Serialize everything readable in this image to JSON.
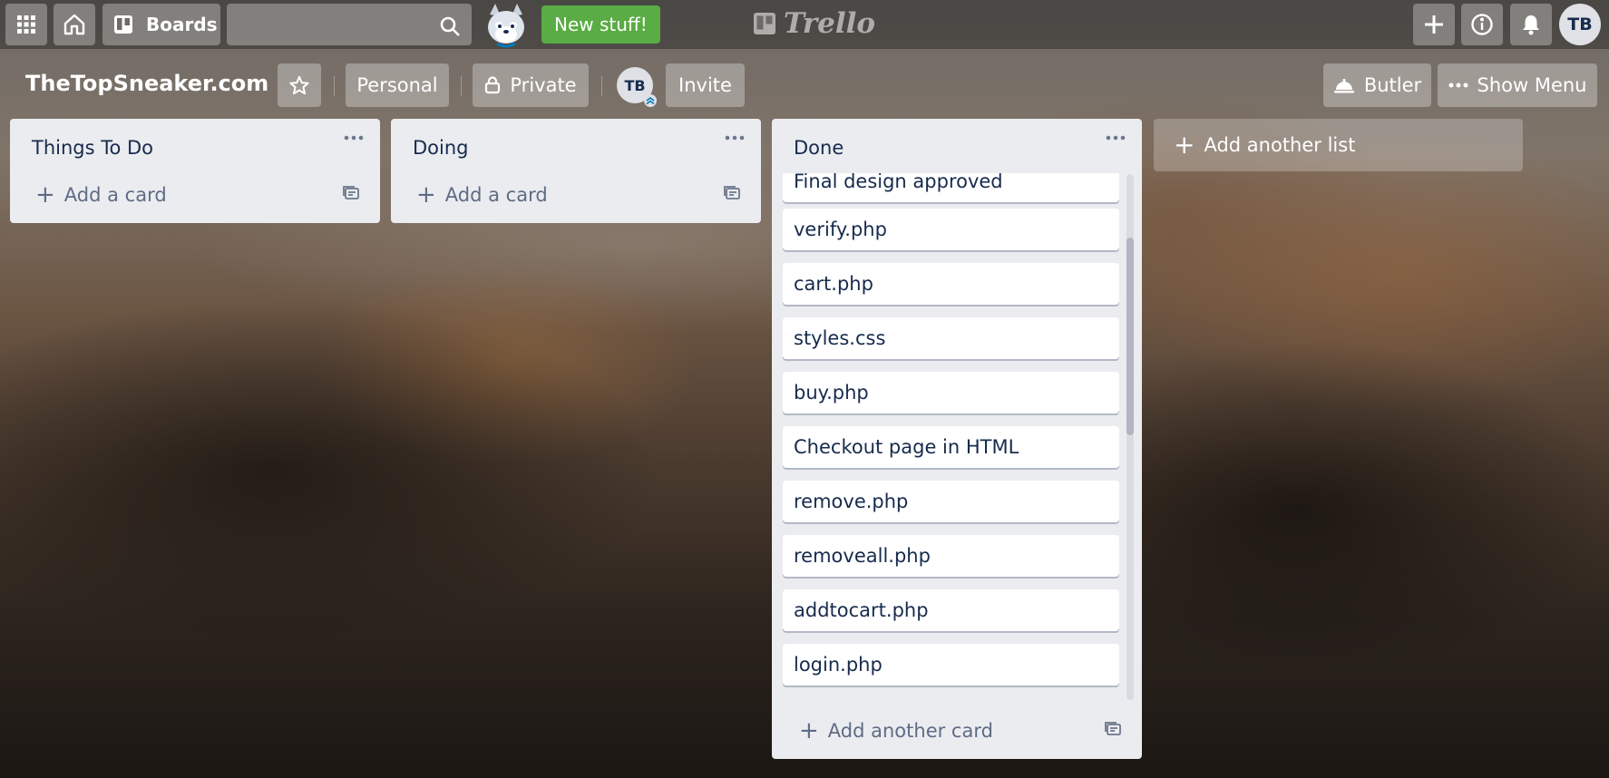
{
  "topbar": {
    "apps_icon": "grid-icon",
    "home_icon": "home-icon",
    "boards_label": "Boards",
    "search_value": "",
    "new_stuff_label": "New stuff!",
    "logo_text": "Trello",
    "user_initials": "TB"
  },
  "board": {
    "title": "TheTopSneaker.com",
    "visibility_team": "Personal",
    "visibility_privacy": "Private",
    "member_initials": "TB",
    "invite_label": "Invite",
    "butler_label": "Butler",
    "show_menu_label": "Show Menu"
  },
  "lists": [
    {
      "title": "Things To Do",
      "add_label": "Add a card",
      "cards": []
    },
    {
      "title": "Doing",
      "add_label": "Add a card",
      "cards": []
    },
    {
      "title": "Done",
      "add_label": "Add another card",
      "cards": [
        "Final design approved",
        "verify.php",
        "cart.php",
        "styles.css",
        "buy.php",
        "Checkout page in HTML",
        "remove.php",
        "removeall.php",
        "addtocart.php",
        "login.php"
      ]
    }
  ],
  "add_list_label": "Add another list",
  "colors": {
    "new_stuff_green": "#5aac44",
    "list_bg": "#ebecf0",
    "card_text": "#172b4d"
  }
}
